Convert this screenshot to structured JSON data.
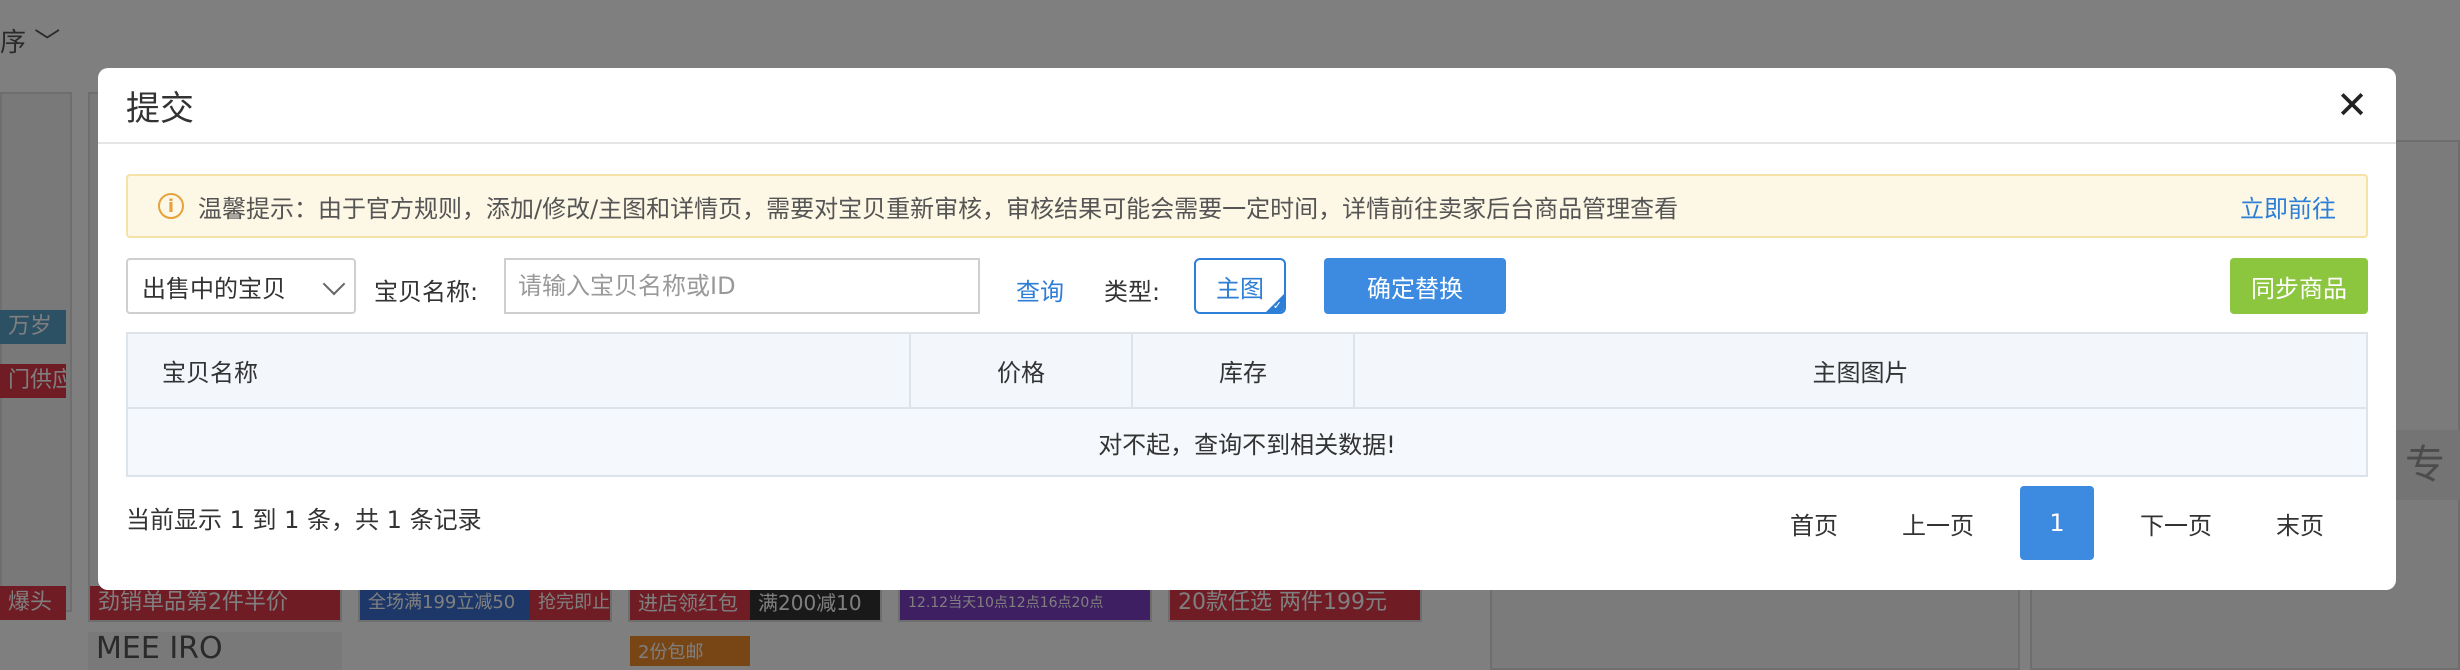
{
  "background": {
    "sort_label": "序",
    "tiles": [
      {
        "text": "万岁"
      },
      {
        "text": "门供应"
      },
      {
        "text": "爆头"
      },
      {
        "text": "劲销单品第2件半价"
      },
      {
        "text": "全场满199立减50"
      },
      {
        "text": "抢完即止"
      },
      {
        "text": "进店领红包"
      },
      {
        "text": "满200减10"
      },
      {
        "text": "12.12当天10点12点16点20点"
      },
      {
        "text": "20款任选 两件199元"
      },
      {
        "text": "2份包邮"
      },
      {
        "text": "MEE IRO"
      }
    ],
    "side_button_glyph": "专"
  },
  "modal": {
    "title": "提交",
    "close_glyph": "✕",
    "notice": {
      "icon_glyph": "i",
      "text": "温馨提示：由于官方规则，添加/修改/主图和详情页，需要对宝贝重新审核，审核结果可能会需要一定时间，详情前往卖家后台商品管理查看",
      "link": "立即前往"
    },
    "toolbar": {
      "select_value": "出售中的宝贝",
      "name_label": "宝贝名称:",
      "search_placeholder": "请输入宝贝名称或ID",
      "query_link": "查询",
      "type_label": "类型:",
      "type_tag": "主图",
      "confirm_button": "确定替换",
      "sync_button": "同步商品"
    },
    "table": {
      "columns": [
        "宝贝名称",
        "价格",
        "库存",
        "主图图片"
      ],
      "empty_message": "对不起，查询不到相关数据!"
    },
    "footer": {
      "info": "当前显示 1 到 1 条，共 1 条记录",
      "pager": {
        "first": "首页",
        "prev": "上一页",
        "current": "1",
        "next": "下一页",
        "last": "末页"
      }
    }
  }
}
